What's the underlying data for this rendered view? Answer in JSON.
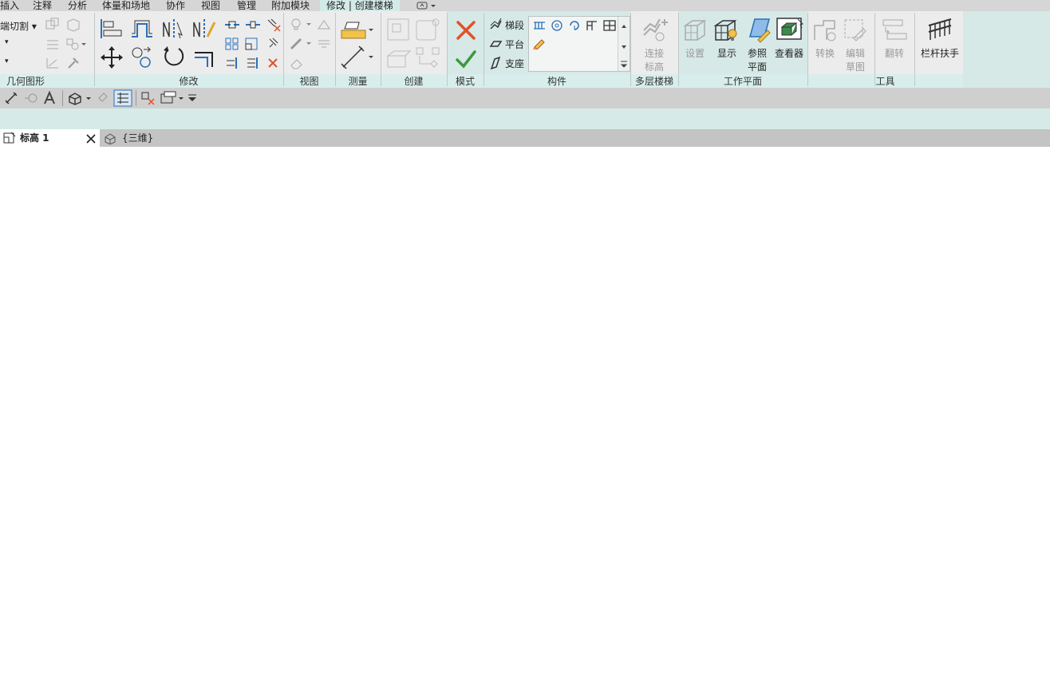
{
  "menu_tabs": [
    "插入",
    "注释",
    "分析",
    "体量和场地",
    "协作",
    "视图",
    "管理",
    "附加模块",
    "修改 | 创建楼梯"
  ],
  "ribbon": {
    "geometry": {
      "label": "几何图形",
      "cut_label": "端切割"
    },
    "modify": {
      "label": "修改"
    },
    "view": {
      "label": "视图"
    },
    "measure": {
      "label": "测量"
    },
    "create": {
      "label": "创建"
    },
    "mode": {
      "label": "模式"
    },
    "components": {
      "label": "构件",
      "run_label": "梯段",
      "landing_label": "平台",
      "support_label": "支座"
    },
    "multistory": {
      "label": "多层楼梯",
      "connect_line1": "连接",
      "connect_line2": "标高"
    },
    "workplane": {
      "label": "工作平面",
      "set_label": "设置",
      "show_label": "显示",
      "ref_line1": "参照",
      "ref_line2": "平面",
      "viewer_label": "查看器"
    },
    "tools": {
      "label": "工具",
      "convert_label": "转换",
      "edit_line1": "编辑",
      "edit_line2": "草图",
      "flip_label": "翻转",
      "railing_label": "栏杆扶手"
    }
  },
  "doc_tabs": [
    {
      "label": "标高 1",
      "active": true
    },
    {
      "label": "{三维}",
      "active": false
    }
  ],
  "colors": {
    "accent": "#d3ebe8",
    "cancel": "#e0522a",
    "finish": "#3c9a3c",
    "icon_blue": "#2a6fb8"
  }
}
